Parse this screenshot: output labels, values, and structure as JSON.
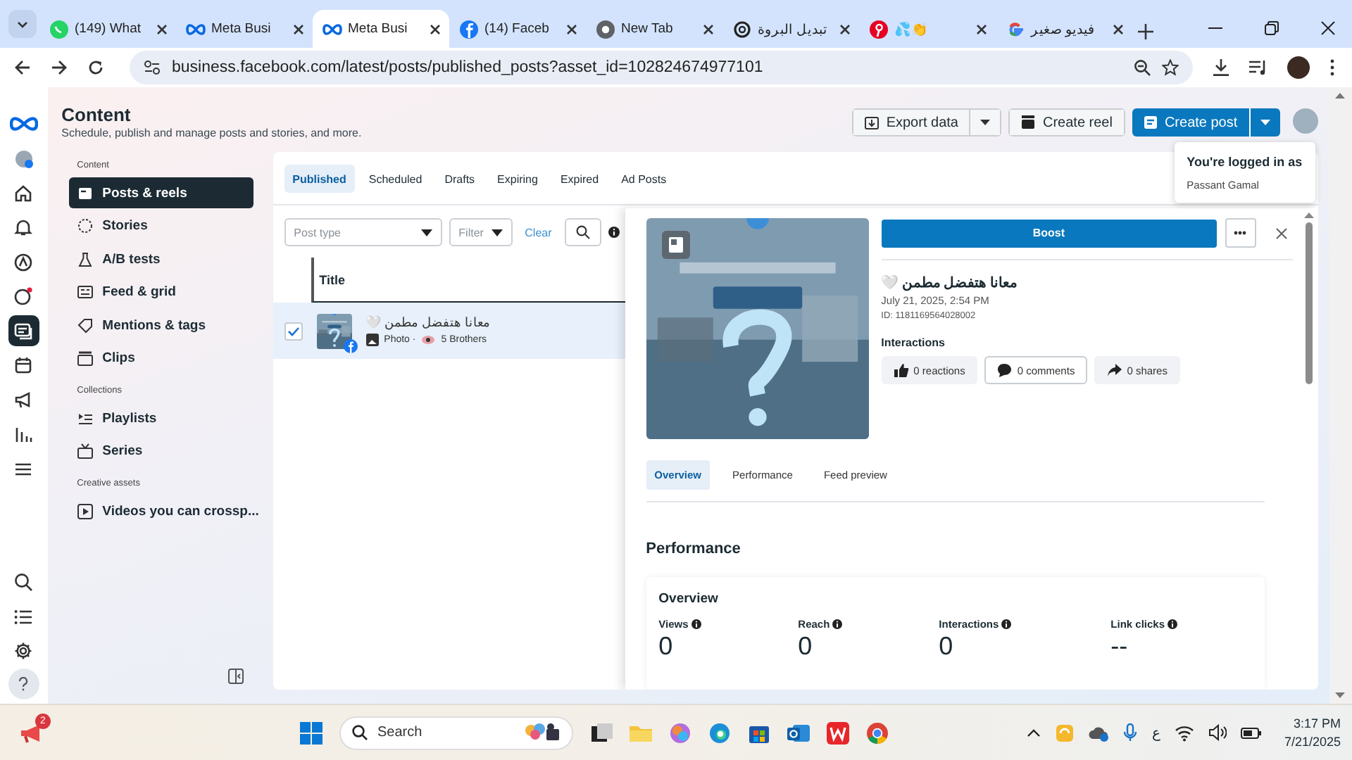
{
  "browser": {
    "tabs": [
      {
        "title": "(149) What",
        "selected": false
      },
      {
        "title": "Meta Busi",
        "selected": false
      },
      {
        "title": "Meta Busi",
        "selected": true
      },
      {
        "title": "(14) Faceb",
        "selected": false
      },
      {
        "title": "New Tab",
        "selected": false
      },
      {
        "title": "تبديل البروة",
        "selected": false
      },
      {
        "title": "💦👏",
        "selected": false
      },
      {
        "title": "فيديو صغير",
        "selected": false
      }
    ],
    "url": "business.facebook.com/latest/posts/published_posts?asset_id=102824674977101"
  },
  "header": {
    "title": "Content",
    "subtitle": "Schedule, publish and manage posts and stories, and more.",
    "actions": [
      {
        "label": "Export data",
        "kind": "outline",
        "split": true
      },
      {
        "label": "Create reel",
        "kind": "outline",
        "split": false
      },
      {
        "label": "Create post",
        "kind": "primary",
        "split": true
      }
    ]
  },
  "login_popup": {
    "heading": "You're logged in as",
    "name": "Passant Gamal"
  },
  "sidebar": {
    "sections": [
      {
        "label": "Content",
        "items": [
          {
            "label": "Posts & reels",
            "selected": true
          },
          {
            "label": "Stories",
            "selected": false
          },
          {
            "label": "A/B tests",
            "selected": false
          },
          {
            "label": "Feed & grid",
            "selected": false
          },
          {
            "label": "Mentions & tags",
            "selected": false
          },
          {
            "label": "Clips",
            "selected": false
          }
        ]
      },
      {
        "label": "Collections",
        "items": [
          {
            "label": "Playlists",
            "selected": false
          },
          {
            "label": "Series",
            "selected": false
          }
        ]
      },
      {
        "label": "Creative assets",
        "items": [
          {
            "label": "Videos you can crossp...",
            "selected": false
          }
        ]
      }
    ]
  },
  "content_tabs": [
    {
      "label": "Published",
      "selected": true
    },
    {
      "label": "Scheduled",
      "selected": false
    },
    {
      "label": "Drafts",
      "selected": false
    },
    {
      "label": "Expiring",
      "selected": false
    },
    {
      "label": "Expired",
      "selected": false
    },
    {
      "label": "Ad Posts",
      "selected": false
    }
  ],
  "filters": {
    "post_type": {
      "placeholder": "Post type"
    },
    "filter": "Filter",
    "clear": "Clear"
  },
  "table": {
    "columns": [
      "Title"
    ],
    "rows": [
      {
        "selected": true,
        "checked": true,
        "title": "معانا هتفضل مطمن 🤍",
        "type": "Photo ·",
        "page": "5 Brothers"
      }
    ]
  },
  "detail": {
    "boost": "Boost",
    "title": "معانا هتفضل مطمن 🤍",
    "date": "July 21, 2025, 2:54 PM",
    "post_id": "ID: 1181169564028002",
    "interactions_heading": "Interactions",
    "interactions": [
      {
        "label": "0 reactions",
        "kind": "like",
        "focused": false
      },
      {
        "label": "0 comments",
        "kind": "comment",
        "focused": true
      },
      {
        "label": "0 shares",
        "kind": "share",
        "focused": false
      }
    ],
    "tabs": [
      {
        "label": "Overview",
        "selected": true
      },
      {
        "label": "Performance",
        "selected": false
      },
      {
        "label": "Feed preview",
        "selected": false
      }
    ],
    "section_title": "Performance",
    "overview": {
      "title": "Overview",
      "metrics": [
        {
          "label": "Views",
          "value": "0"
        },
        {
          "label": "Reach",
          "value": "0"
        },
        {
          "label": "Interactions",
          "value": "0"
        },
        {
          "label": "Link clicks",
          "value": "--"
        }
      ]
    }
  },
  "taskbar": {
    "notification_count": "2",
    "search_label": "Search",
    "input_language": "ع",
    "time": "3:17 PM",
    "date": "7/21/2025"
  }
}
